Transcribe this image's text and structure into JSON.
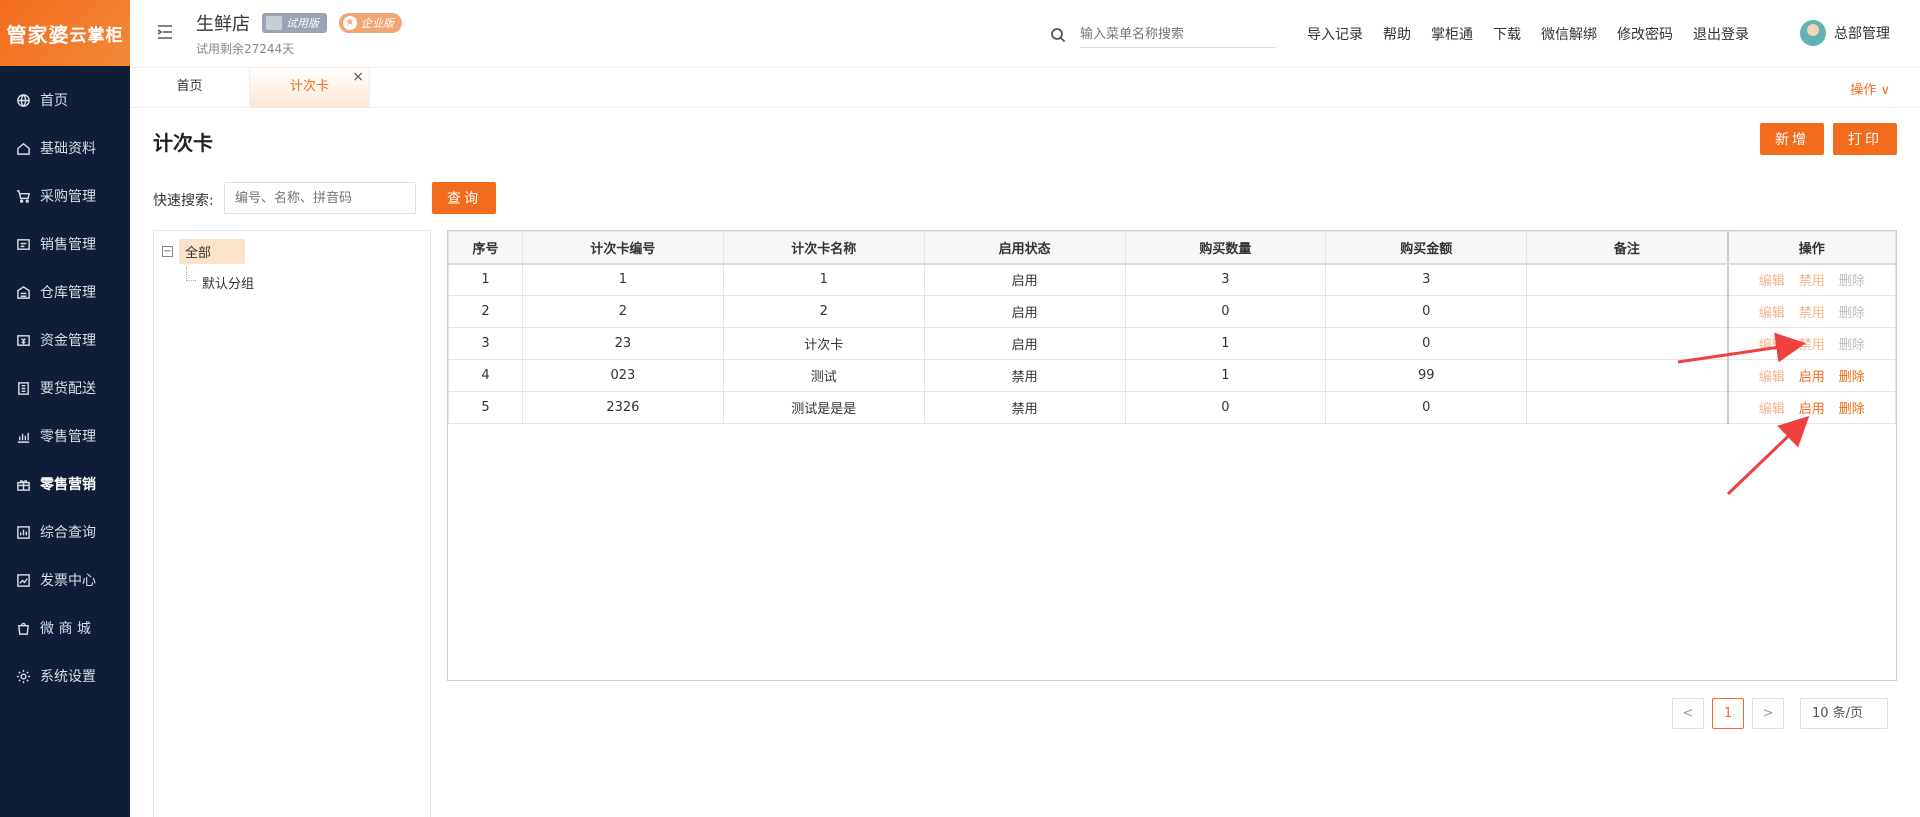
{
  "sidebar": {
    "logo_main": "管家婆",
    "logo_sub": "云掌柜",
    "items": [
      {
        "label": "首页",
        "icon": "globe-icon"
      },
      {
        "label": "基础资料",
        "icon": "home-icon"
      },
      {
        "label": "采购管理",
        "icon": "cart-icon"
      },
      {
        "label": "销售管理",
        "icon": "register-icon"
      },
      {
        "label": "仓库管理",
        "icon": "warehouse-icon"
      },
      {
        "label": "资金管理",
        "icon": "money-icon"
      },
      {
        "label": "要货配送",
        "icon": "clipboard-icon"
      },
      {
        "label": "零售管理",
        "icon": "bar-chart-icon"
      },
      {
        "label": "零售营销",
        "icon": "gift-icon"
      },
      {
        "label": "综合查询",
        "icon": "column-chart-icon"
      },
      {
        "label": "发票中心",
        "icon": "trend-icon"
      },
      {
        "label": "微 商 城",
        "icon": "bag-icon"
      },
      {
        "label": "系统设置",
        "icon": "gear-icon"
      }
    ],
    "active_index": 8
  },
  "header": {
    "store_name": "生鲜店",
    "badge_trial": "试用版",
    "badge_pro": "企业版",
    "trial_left": "试用剩余27244天",
    "search_placeholder": "输入菜单名称搜索",
    "links": [
      "导入记录",
      "帮助",
      "掌柜通",
      "下载",
      "微信解绑",
      "修改密码",
      "退出登录"
    ],
    "user_name": "总部管理"
  },
  "tabs": {
    "home": "首页",
    "active": "计次卡",
    "close": "×",
    "ops": "操作 ∨"
  },
  "page": {
    "title": "计次卡",
    "add_label": "新增",
    "print_label": "打印",
    "quick_search_label": "快速搜索:",
    "quick_search_placeholder": "编号、名称、拼音码",
    "query_label": "查询"
  },
  "tree": {
    "toggle": "−",
    "root": "全部",
    "child": "默认分组"
  },
  "table": {
    "headers": [
      "序号",
      "计次卡编号",
      "计次卡名称",
      "启用状态",
      "购买数量",
      "购买金额",
      "备注",
      "操作"
    ],
    "rows": [
      {
        "no": "1",
        "code": "1",
        "name": "1",
        "status": "启用",
        "qty": "3",
        "amount": "3",
        "remark": "",
        "toggle": "禁用",
        "toggle_state": "dim",
        "del_state": "off"
      },
      {
        "no": "2",
        "code": "2",
        "name": "2",
        "status": "启用",
        "qty": "0",
        "amount": "0",
        "remark": "",
        "toggle": "禁用",
        "toggle_state": "dim",
        "del_state": "off"
      },
      {
        "no": "3",
        "code": "23",
        "name": "计次卡",
        "status": "启用",
        "qty": "1",
        "amount": "0",
        "remark": "",
        "toggle": "禁用",
        "toggle_state": "dim",
        "del_state": "off"
      },
      {
        "no": "4",
        "code": "023",
        "name": "测试",
        "status": "禁用",
        "qty": "1",
        "amount": "99",
        "remark": "",
        "toggle": "启用",
        "toggle_state": "on",
        "del_state": "on"
      },
      {
        "no": "5",
        "code": "2326",
        "name": "测试是是是",
        "status": "禁用",
        "qty": "0",
        "amount": "0",
        "remark": "",
        "toggle": "启用",
        "toggle_state": "on",
        "del_state": "on"
      }
    ],
    "edit_label": "编辑",
    "delete_label": "删除"
  },
  "pager": {
    "prev": "<",
    "current": "1",
    "next": ">",
    "page_size": "10 条/页"
  },
  "colors": {
    "accent": "#f36b1c",
    "sidebar_bg": "#0f1e36",
    "annotation": "#f04040"
  }
}
